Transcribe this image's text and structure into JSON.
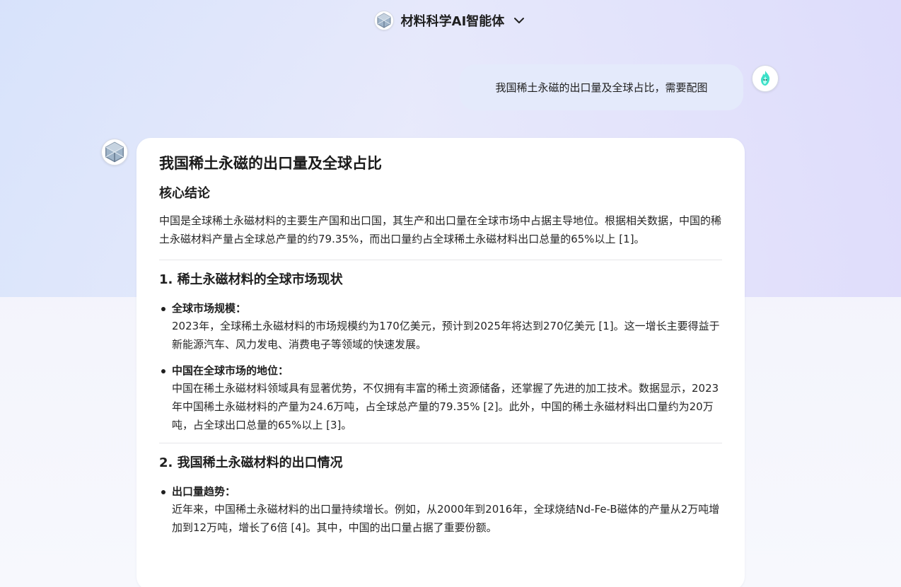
{
  "header": {
    "title": "材料科学AI智能体",
    "logo_icon": "crystal-lattice-icon",
    "dropdown_icon": "chevron-down-icon"
  },
  "user_message": {
    "text": "我国稀土永磁的出口量及全球占比，需要配图",
    "avatar_icon": "flame-avatar-icon"
  },
  "assistant": {
    "avatar_icon": "crystal-lattice-icon",
    "title": "我国稀土永磁的出口量及全球占比",
    "core_heading": "核心结论",
    "core_text": "中国是全球稀土永磁材料的主要生产国和出口国，其生产和出口量在全球市场中占据主导地位。根据相关数据，中国的稀土永磁材料产量占全球总产量的约79.35%，而出口量约占全球稀土永磁材料出口总量的65%以上 [1]。",
    "sections": [
      {
        "heading": "1. 稀土永磁材料的全球市场现状",
        "items": [
          {
            "label": "全球市场规模：",
            "text": "2023年，全球稀土永磁材料的市场规模约为170亿美元，预计到2025年将达到270亿美元 [1]。这一增长主要得益于新能源汽车、风力发电、消费电子等领域的快速发展。"
          },
          {
            "label": "中国在全球市场的地位：",
            "text": "中国在稀土永磁材料领域具有显著优势，不仅拥有丰富的稀土资源储备，还掌握了先进的加工技术。数据显示，2023年中国稀土永磁材料的产量为24.6万吨，占全球总产量的79.35% [2]。此外，中国的稀土永磁材料出口量约为20万吨，占全球出口总量的65%以上 [3]。"
          }
        ]
      },
      {
        "heading": "2. 我国稀土永磁材料的出口情况",
        "items": [
          {
            "label": "出口量趋势：",
            "text": "近年来，中国稀土永磁材料的出口量持续增长。例如，从2000年到2016年，全球烧结Nd-Fe-B磁体的产量从2万吨增加到12万吨，增长了6倍 [4]。其中，中国的出口量占据了重要份额。"
          }
        ]
      }
    ]
  }
}
